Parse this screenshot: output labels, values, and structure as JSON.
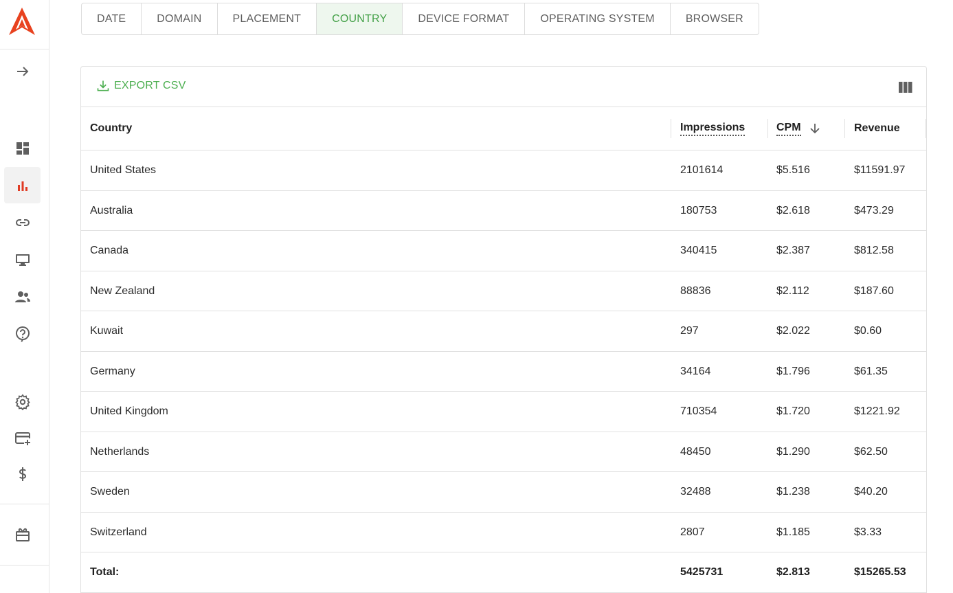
{
  "tabs": [
    {
      "label": "DATE",
      "active": false
    },
    {
      "label": "DOMAIN",
      "active": false
    },
    {
      "label": "PLACEMENT",
      "active": false
    },
    {
      "label": "COUNTRY",
      "active": true
    },
    {
      "label": "DEVICE FORMAT",
      "active": false
    },
    {
      "label": "OPERATING SYSTEM",
      "active": false
    },
    {
      "label": "BROWSER",
      "active": false
    }
  ],
  "toolbar": {
    "export_label": "EXPORT CSV"
  },
  "table": {
    "columns": [
      "Country",
      "Impressions",
      "CPM",
      "Revenue"
    ],
    "rows": [
      [
        "United States",
        "2101614",
        "$5.516",
        "$11591.97"
      ],
      [
        "Australia",
        "180753",
        "$2.618",
        "$473.29"
      ],
      [
        "Canada",
        "340415",
        "$2.387",
        "$812.58"
      ],
      [
        "New Zealand",
        "88836",
        "$2.112",
        "$187.60"
      ],
      [
        "Kuwait",
        "297",
        "$2.022",
        "$0.60"
      ],
      [
        "Germany",
        "34164",
        "$1.796",
        "$61.35"
      ],
      [
        "United Kingdom",
        "710354",
        "$1.720",
        "$1221.92"
      ],
      [
        "Netherlands",
        "48450",
        "$1.290",
        "$62.50"
      ],
      [
        "Sweden",
        "32488",
        "$1.238",
        "$40.20"
      ],
      [
        "Switzerland",
        "2807",
        "$1.185",
        "$3.33"
      ]
    ],
    "total": [
      "Total:",
      "5425731",
      "$2.813",
      "$15265.53"
    ]
  },
  "colors": {
    "accent_green": "#4caf50",
    "active_tab_bg": "#eef7ee",
    "logo_red": "#e8421f",
    "active_nav_red": "#e03b24"
  },
  "icons": {
    "sidebar": [
      "expand-arrow-icon",
      "dashboard-icon",
      "bar-chart-icon",
      "link-icon",
      "monitor-icon",
      "users-icon",
      "help-icon",
      "gear-icon",
      "add-card-icon",
      "dollar-icon",
      "gift-icon"
    ],
    "toolbar": [
      "download-icon",
      "columns-icon"
    ],
    "sort": "arrow-down-icon"
  }
}
